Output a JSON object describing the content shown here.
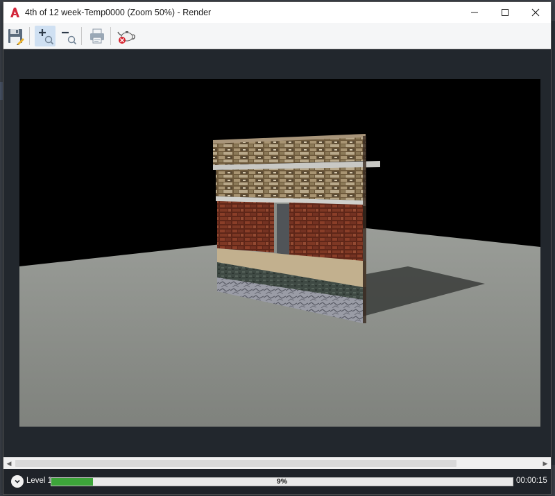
{
  "window": {
    "title": "4th of 12 week-Temp0000 (Zoom 50%) - Render",
    "app_icon": "autocad-logo-icon"
  },
  "controls": [
    "minimize-icon",
    "maximize-icon",
    "close-icon"
  ],
  "toolbar": {
    "buttons": [
      {
        "name": "save-image",
        "icon": "floppy-disk-icon"
      },
      {
        "name": "zoom-in",
        "icon": "zoom-in-icon"
      },
      {
        "name": "zoom-out",
        "icon": "zoom-out-icon"
      },
      {
        "name": "print",
        "icon": "printer-icon"
      },
      {
        "name": "cancel-render",
        "icon": "teapot-cancel-icon"
      }
    ]
  },
  "colors": {
    "progress": "#3da53a",
    "canvas_bg": "#000000",
    "ground": "#8a8d88",
    "brick": "#7a3a26",
    "stone": "#8a7a5a"
  },
  "status": {
    "level": "Level 1",
    "progress_percent": 9,
    "progress_text": "9%",
    "elapsed": "00:00:15"
  }
}
